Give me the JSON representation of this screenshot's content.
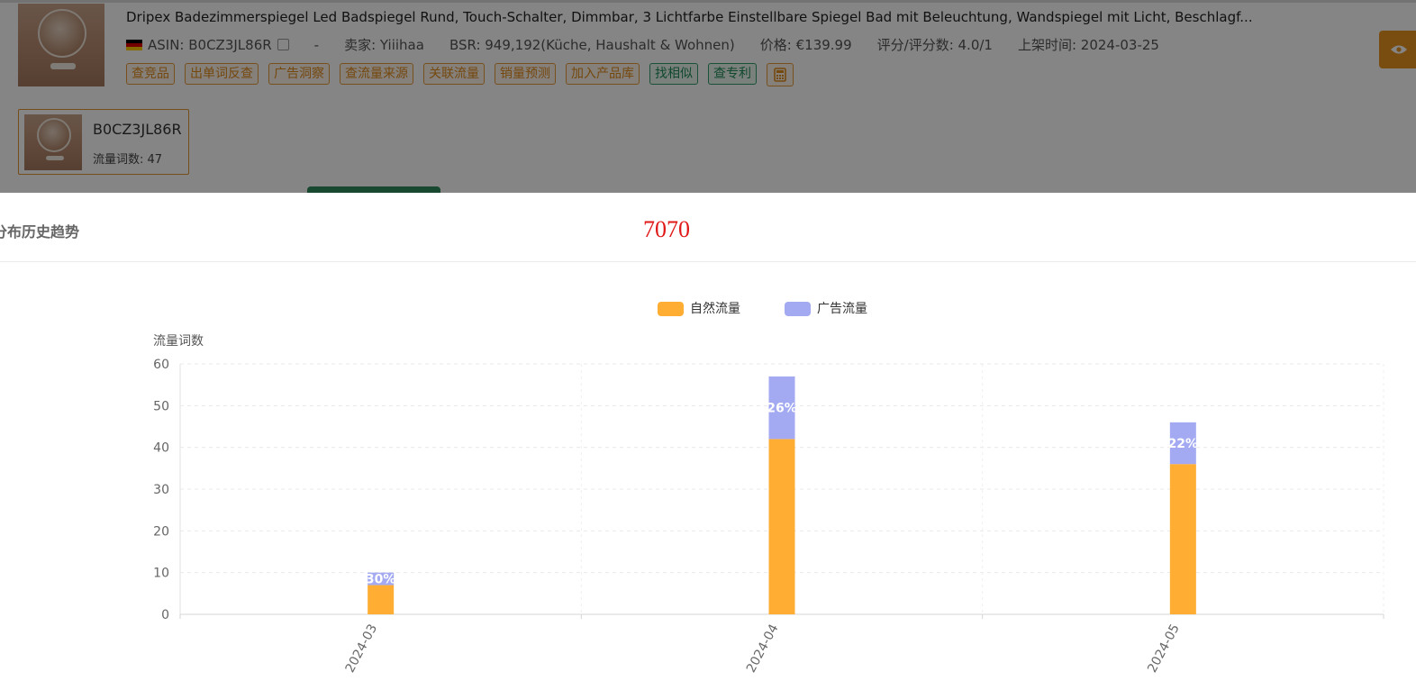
{
  "product": {
    "title": "Dripex Badezimmerspiegel Led Badspiegel Rund, Touch-Schalter, Dimmbar, 3 Lichtfarbe Einstellbare Spiegel Bad mit Beleuchtung, Wandspiegel mit Licht, Beschlagf...",
    "asin": "ASIN: B0CZ3JL86R",
    "dash": "-",
    "seller": "卖家: Yiiihaa",
    "bsr": "BSR: 949,192(Küche, Haushalt & Wohnen)",
    "price": "价格: €139.99",
    "rating": "评分/评分数: 4.0/1",
    "listed": "上架时间: 2024-03-25",
    "flag_icon": "germany-flag-icon",
    "tags": [
      "查竞品",
      "出单词反查",
      "广告洞察",
      "查流量来源",
      "关联流量",
      "销量预测",
      "加入产品库"
    ],
    "green_tags": [
      "找相似",
      "查专利"
    ],
    "calc_icon": "calculator-icon"
  },
  "asin_card": {
    "code": "B0CZ3JL86R",
    "count": "流量词数: 47"
  },
  "modal": {
    "title": "分布历史趋势",
    "red_number": "7070"
  },
  "colors": {
    "organic": "#ffad33",
    "ad": "#a3aaf2",
    "accent": "#e8951f",
    "green": "#2e8a5c"
  },
  "chart_data": {
    "type": "bar",
    "stacked": true,
    "categories": [
      "2024-03",
      "2024-04",
      "2024-05"
    ],
    "series": [
      {
        "name": "自然流量",
        "values": [
          7,
          42,
          36
        ]
      },
      {
        "name": "广告流量",
        "values": [
          3,
          15,
          10
        ]
      }
    ],
    "data_labels": [
      "30%",
      "26%",
      "22%"
    ],
    "ylabel": "流量词数",
    "ylim": [
      0,
      60
    ],
    "yticks": [
      0,
      10,
      20,
      30,
      40,
      50,
      60
    ],
    "grid": true,
    "legend_position": "top-center"
  }
}
